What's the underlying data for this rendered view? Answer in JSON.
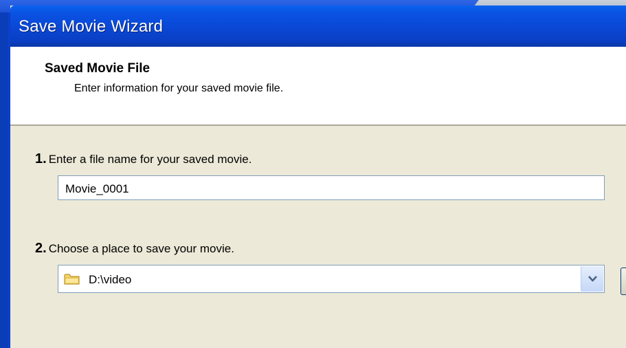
{
  "window": {
    "title": "Save Movie Wizard"
  },
  "header": {
    "title": "Saved Movie File",
    "subtitle": "Enter information for your saved movie file."
  },
  "step1": {
    "number": "1.",
    "label": "Enter a file name for your saved movie.",
    "value": "Movie_0001"
  },
  "step2": {
    "number": "2.",
    "label": "Choose a place to save your movie.",
    "value": "D:\\video",
    "icon": "folder-icon"
  },
  "colors": {
    "titlebar": "#0a47d4",
    "body": "#ece9d8",
    "field_border": "#7f9db9"
  }
}
